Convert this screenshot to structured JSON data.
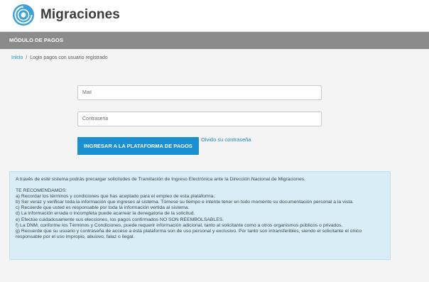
{
  "header": {
    "brand": "Migraciones"
  },
  "module_bar": {
    "title": "MÓDULO DE PAGOS"
  },
  "breadcrumb": {
    "home": "Inicio",
    "separator": "/",
    "current": "Login pagos con usuario registrado"
  },
  "form": {
    "mail_placeholder": "Mail",
    "password_placeholder": "Contraseña",
    "submit_label": "INGRESAR A LA PLATAFORMA DE PAGOS",
    "forgot_label": "Olvido su contraseña"
  },
  "info": {
    "intro": "A través de este sistema podrás precargar solicitudes de Tramitación de Ingreso Electrónica ante la Dirección Nacional de Migraciones.",
    "heading": "TE RECOMENDAMOS:",
    "items": [
      "a) Recordar los términos y condiciones que has aceptado para el empleo de esta plataforma.",
      "b) Ser veraz y verificar toda la información que ingreses al sistema. Tómese su tiempo e intente tener en todo momento su documentación personal a la vista.",
      "c) Recuerde que usted es responsable por toda la información vertida al sistema.",
      "d) La información errada o incompleta puede acarrear la denegatoria de la solicitud.",
      "e) Efectúe cuidadosamente sus elecciones, los pagos confirmados NO SON REEMBOLSABLES.",
      "f) La DNM, conforme los Términos y Condiciones, puede requerir información adicional, tanto al solicitante como a otros organismos públicos o privados.",
      "g) Recuerde que su usuario y contraseña de acceso a ésta plataforma son de uso personal y exclusivo. Por tanto son intransferibles, siendo el solicitante el único responsable por el uso impropio, abusivo, falaz o ilegal."
    ]
  },
  "colors": {
    "accent": "#1a8fd1",
    "logo": "#3aa0d8",
    "module_bar": "#8b8b8b",
    "info_bg": "#d9edf7"
  },
  "icons": {
    "logo": "migraciones-logo-icon"
  }
}
